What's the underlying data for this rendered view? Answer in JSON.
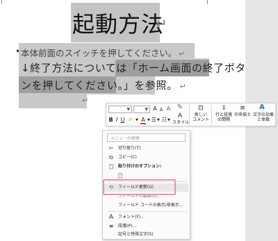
{
  "document": {
    "title": "起動方法",
    "line1": "本体前面のスイッチを押してください。",
    "line2": "↓終了方法については「ホーム画面の終了ボタ",
    "line3": "ンを押してください。」を参照。",
    "return_mark": "↵",
    "bullet": "•"
  },
  "toolbar": {
    "font_size_up": "A",
    "font_size_down": "A",
    "clear_format": "A",
    "bold": "B",
    "italic": "I",
    "underline": "U",
    "font_color": "A",
    "style_label": "スタイル",
    "new_comment_label": "新しい\nコメント",
    "line_spacing_label": "行と段落\nの間隔",
    "center_label": "中央揃え",
    "text_effect_label": "文字の効果\nと体裁"
  },
  "context_menu": {
    "search_placeholder": "メニューの検索",
    "items": [
      {
        "label": "切り取り(T)",
        "icon": "scissors-icon",
        "glyph": "✂"
      },
      {
        "label": "コピー(C)",
        "icon": "copy-icon",
        "glyph": "⧉"
      },
      {
        "label": "貼り付けのオプション:",
        "icon": "paste-icon",
        "glyph": "📋"
      },
      {
        "label": "",
        "icon": "paste-text-only-icon",
        "glyph": "📋"
      },
      {
        "label": "フィールド更新(U)",
        "icon": "update-field-icon",
        "glyph": "⟲"
      },
      {
        "label": "フィールドの編集(E)...",
        "icon": "",
        "glyph": ""
      },
      {
        "label": "フィールド コードの表示/非表示...",
        "icon": "",
        "glyph": ""
      },
      {
        "label": "フォント(F)...",
        "icon": "font-icon",
        "glyph": "A"
      },
      {
        "label": "段落(P)...",
        "icon": "paragraph-icon",
        "glyph": "≡"
      },
      {
        "label": "記号と特殊文字(S)",
        "icon": "",
        "glyph": ""
      }
    ]
  },
  "colors": {
    "highlight_border": "#ef8fbe",
    "selection_light": "#c9c9c9",
    "selection_dark": "#9e9e9e",
    "font_color_underline": "#d83b3b",
    "accent": "#335f9e"
  }
}
